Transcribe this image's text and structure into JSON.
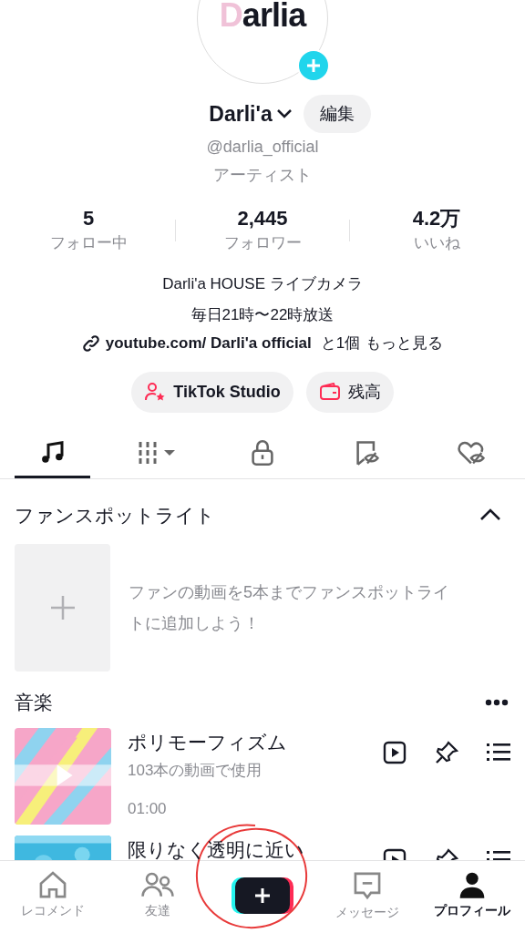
{
  "profile": {
    "avatar_logo": "Darlia",
    "name": "Darli'a",
    "edit_button": "編集",
    "handle": "@darlia_official",
    "category": "アーティスト"
  },
  "stats": [
    {
      "value": "5",
      "label": "フォロー中"
    },
    {
      "value": "2,445",
      "label": "フォロワー"
    },
    {
      "value": "4.2万",
      "label": "いいね"
    }
  ],
  "bio": [
    "Darli'a HOUSE ライブカメラ",
    "毎日21時〜22時放送"
  ],
  "link": {
    "url": "youtube.com/ Darli'a official",
    "extra": "と1個",
    "more": "もっと見る"
  },
  "action_buttons": [
    {
      "kind": "studio",
      "label": "TikTok Studio"
    },
    {
      "kind": "wallet",
      "label": "残高"
    }
  ],
  "tabs": [
    {
      "kind": "music",
      "selected": true
    },
    {
      "kind": "grid",
      "selected": false
    },
    {
      "kind": "lock",
      "selected": false
    },
    {
      "kind": "bookmark",
      "selected": false
    },
    {
      "kind": "heart",
      "selected": false
    }
  ],
  "fan_spotlight": {
    "title": "ファンスポットライト",
    "expanded": true,
    "hint": "ファンの動画を5本までファンスポットライトに追加しよう！"
  },
  "music": {
    "title": "音楽",
    "songs": [
      {
        "title": "ポリモーフィズム",
        "usage": "103本の動画で使用",
        "duration": "01:00",
        "kind": "picture"
      },
      {
        "title": "限りなく透明に近い",
        "kind": "picture"
      }
    ]
  },
  "bottom_nav": [
    {
      "kind": "home",
      "label": "レコメンド",
      "selected": false
    },
    {
      "kind": "friends",
      "label": "友達",
      "selected": false
    },
    {
      "kind": "create"
    },
    {
      "kind": "messages",
      "label": "メッセージ",
      "selected": false
    },
    {
      "kind": "profile",
      "label": "プロフィール",
      "selected": true
    }
  ]
}
